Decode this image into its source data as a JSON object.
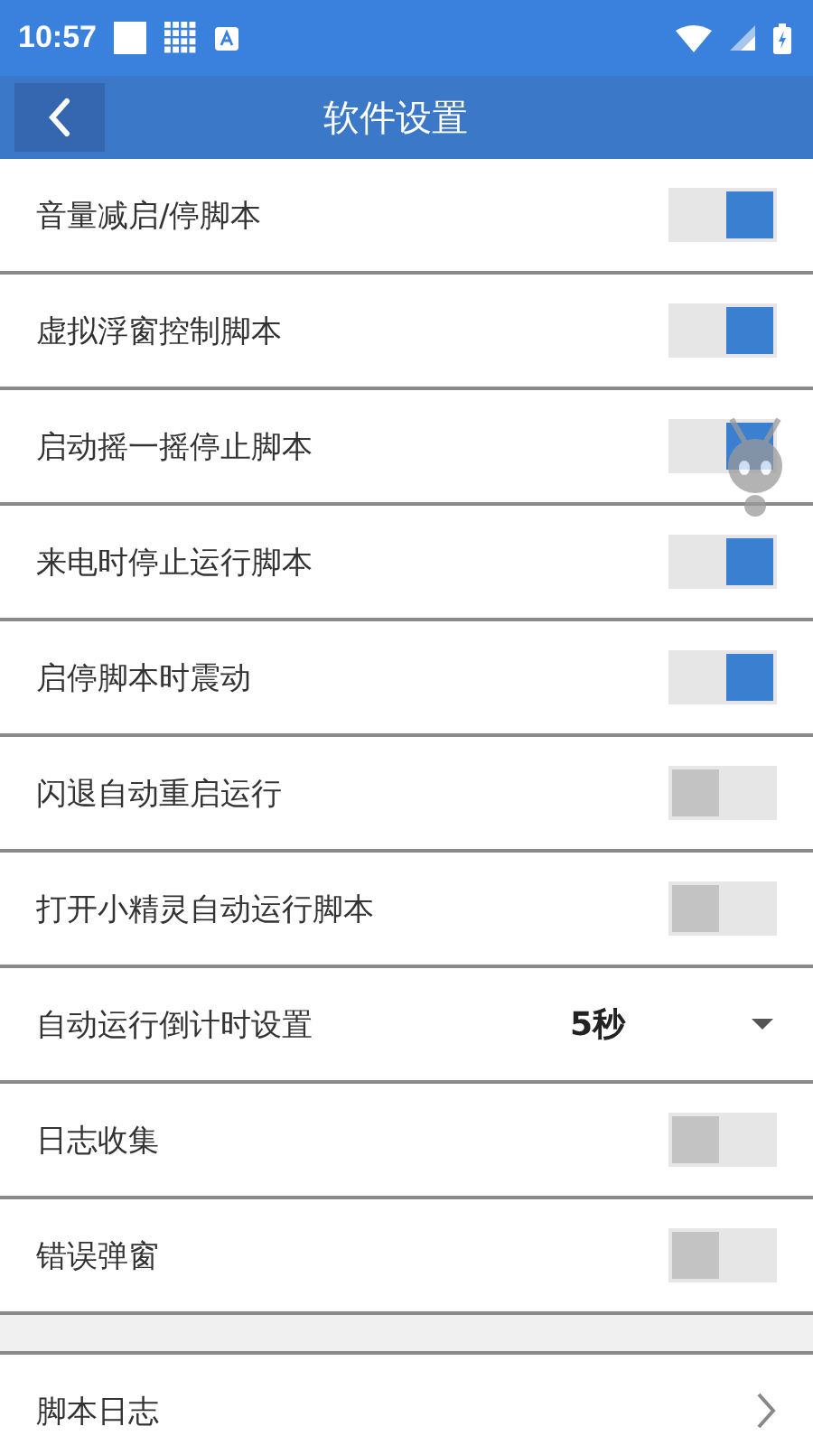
{
  "status_bar": {
    "time": "10:57"
  },
  "toolbar": {
    "title": "软件设置"
  },
  "settings": [
    {
      "kind": "toggle",
      "label": "音量减启/停脚本",
      "on": true
    },
    {
      "kind": "toggle",
      "label": "虚拟浮窗控制脚本",
      "on": true
    },
    {
      "kind": "toggle",
      "label": "启动摇一摇停止脚本",
      "on": true
    },
    {
      "kind": "toggle",
      "label": "来电时停止运行脚本",
      "on": true
    },
    {
      "kind": "toggle",
      "label": "启停脚本时震动",
      "on": true
    },
    {
      "kind": "toggle",
      "label": "闪退自动重启运行",
      "on": false
    },
    {
      "kind": "toggle",
      "label": "打开小精灵自动运行脚本",
      "on": false
    },
    {
      "kind": "dropdown",
      "label": "自动运行倒计时设置",
      "value": "5秒"
    },
    {
      "kind": "toggle",
      "label": "日志收集",
      "on": false
    },
    {
      "kind": "toggle",
      "label": "错误弹窗",
      "on": false
    },
    {
      "kind": "gap"
    },
    {
      "kind": "link",
      "label": "脚本日志"
    }
  ]
}
